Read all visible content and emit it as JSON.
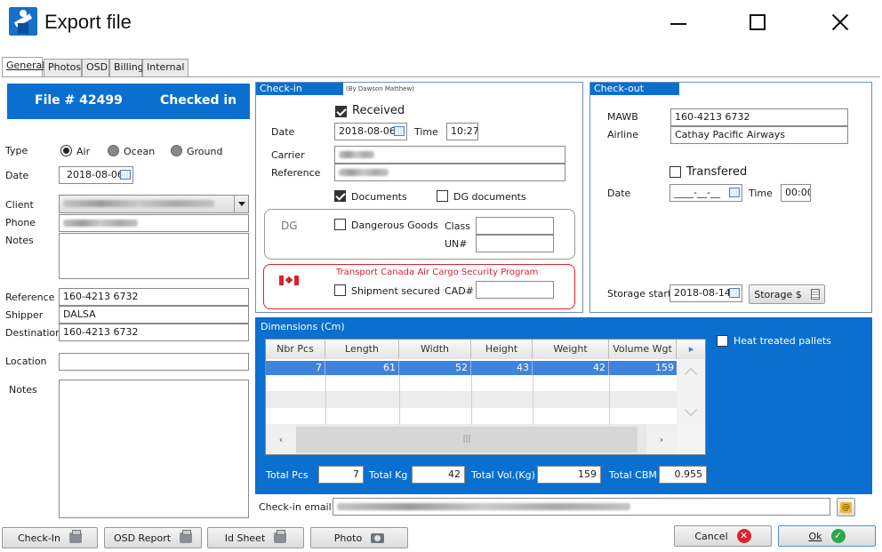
{
  "window": {
    "title": "Export file"
  },
  "tabs": [
    "General",
    "Photos",
    "OSD",
    "Billing",
    "Internal"
  ],
  "file_header": {
    "file_no": "File # 42499",
    "status": "Checked in"
  },
  "general": {
    "type_label": "Type",
    "types": [
      "Air",
      "Ocean",
      "Ground"
    ],
    "date_label": "Date",
    "date": "2018-08-06",
    "client_label": "Client",
    "phone_label": "Phone",
    "notes_label": "Notes",
    "reference_label": "Reference",
    "reference": "160-4213 6732",
    "shipper_label": "Shipper",
    "shipper": "DALSA",
    "destination_label": "Destination",
    "destination": "160-4213 6732",
    "location_label": "Location",
    "notes2_label": "Notes"
  },
  "checkin": {
    "title": "Check-in",
    "by": "(By Dawson Matthew)",
    "received_label": "Received",
    "date_label": "Date",
    "date": "2018-08-06",
    "time_label": "Time",
    "time": "10:27",
    "carrier_label": "Carrier",
    "reference_label": "Reference",
    "documents_label": "Documents",
    "dg_documents_label": "DG documents",
    "dg_label": "DG",
    "dangerous_goods_label": "Dangerous Goods",
    "class_label": "Class",
    "un_label": "UN#",
    "tc_title": "Transport Canada Air Cargo Security Program",
    "shipment_secured_label": "Shipment secured",
    "cad_label": "CAD#"
  },
  "checkout": {
    "title": "Check-out",
    "mawb_label": "MAWB",
    "mawb": "160-4213 6732",
    "airline_label": "Airline",
    "airline": "Cathay Pacific Airways",
    "transfered_label": "Transfered",
    "date_label": "Date",
    "date_mask": "____-__-__",
    "time_label": "Time",
    "time": "00:00",
    "storage_start_label": "Storage start",
    "storage_start": "2018-08-14",
    "storage_button": "Storage $"
  },
  "dimensions": {
    "title": "Dimensions (Cm)",
    "columns": [
      "Nbr Pcs",
      "Length",
      "Width",
      "Height",
      "Weight",
      "Volume Wgt"
    ],
    "rows": [
      [
        "7",
        "61",
        "52",
        "43",
        "42",
        "159"
      ]
    ],
    "heat_treated_label": "Heat treated pallets",
    "total_pcs_label": "Total Pcs",
    "total_pcs": "7",
    "total_kg_label": "Total Kg",
    "total_kg": "42",
    "total_vol_label": "Total Vol.(Kg)",
    "total_vol": "159",
    "total_cbm_label": "Total CBM",
    "total_cbm": "0.955"
  },
  "checkin_email_label": "Check-in email",
  "footer": {
    "checkin_button": "Check-In",
    "osd_report_button": "OSD Report",
    "id_sheet_button": "Id Sheet",
    "photo_button": "Photo",
    "cancel_button": "Cancel",
    "ok_button": "Ok"
  },
  "colors": {
    "accent": "#0b6fcf",
    "danger": "#d9232e",
    "ok": "#2aa84a"
  }
}
